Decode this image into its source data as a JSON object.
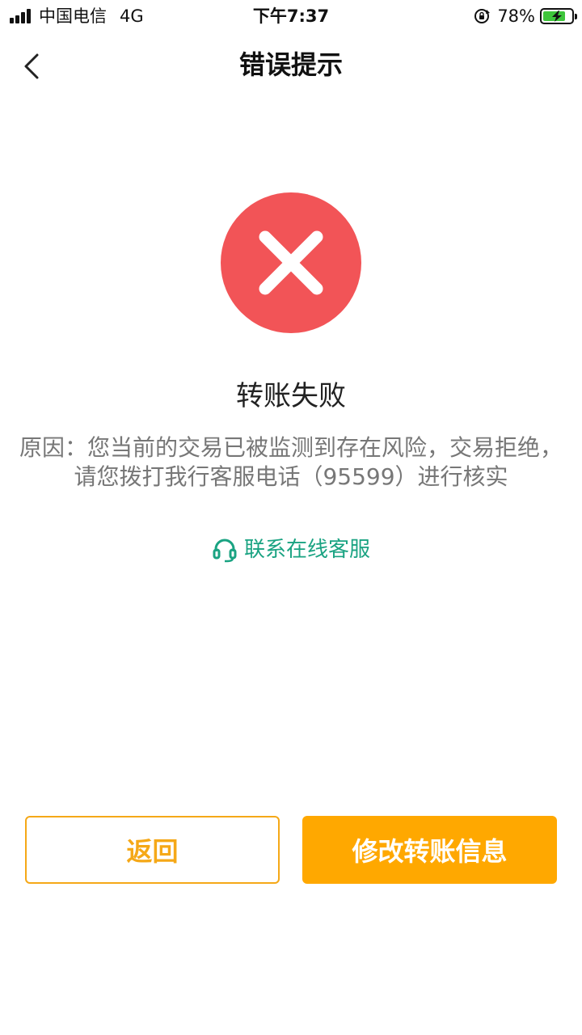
{
  "status_bar": {
    "carrier": "中国电信",
    "network": "4G",
    "time": "下午7:37",
    "battery_percent": "78%",
    "battery_level": 0.78,
    "icons": [
      "signal-icon",
      "rotation-lock-icon",
      "battery-charging-icon"
    ]
  },
  "nav": {
    "title": "错误提示",
    "back_icon": "chevron-left-icon"
  },
  "result": {
    "icon": "error-x-icon",
    "title": "转账失败",
    "reason": "原因：您当前的交易已被监测到存在风险，交易拒绝，请您拨打我行客服电话（95599）进行核实"
  },
  "contact": {
    "icon": "headset-icon",
    "label": "联系在线客服"
  },
  "buttons": {
    "back_label": "返回",
    "modify_label": "修改转账信息"
  },
  "colors": {
    "error_red": "#f25457",
    "accent_orange": "#ffa800",
    "outline_orange": "#f5a817",
    "link_green": "#1aa382",
    "reason_gray": "#777777"
  }
}
